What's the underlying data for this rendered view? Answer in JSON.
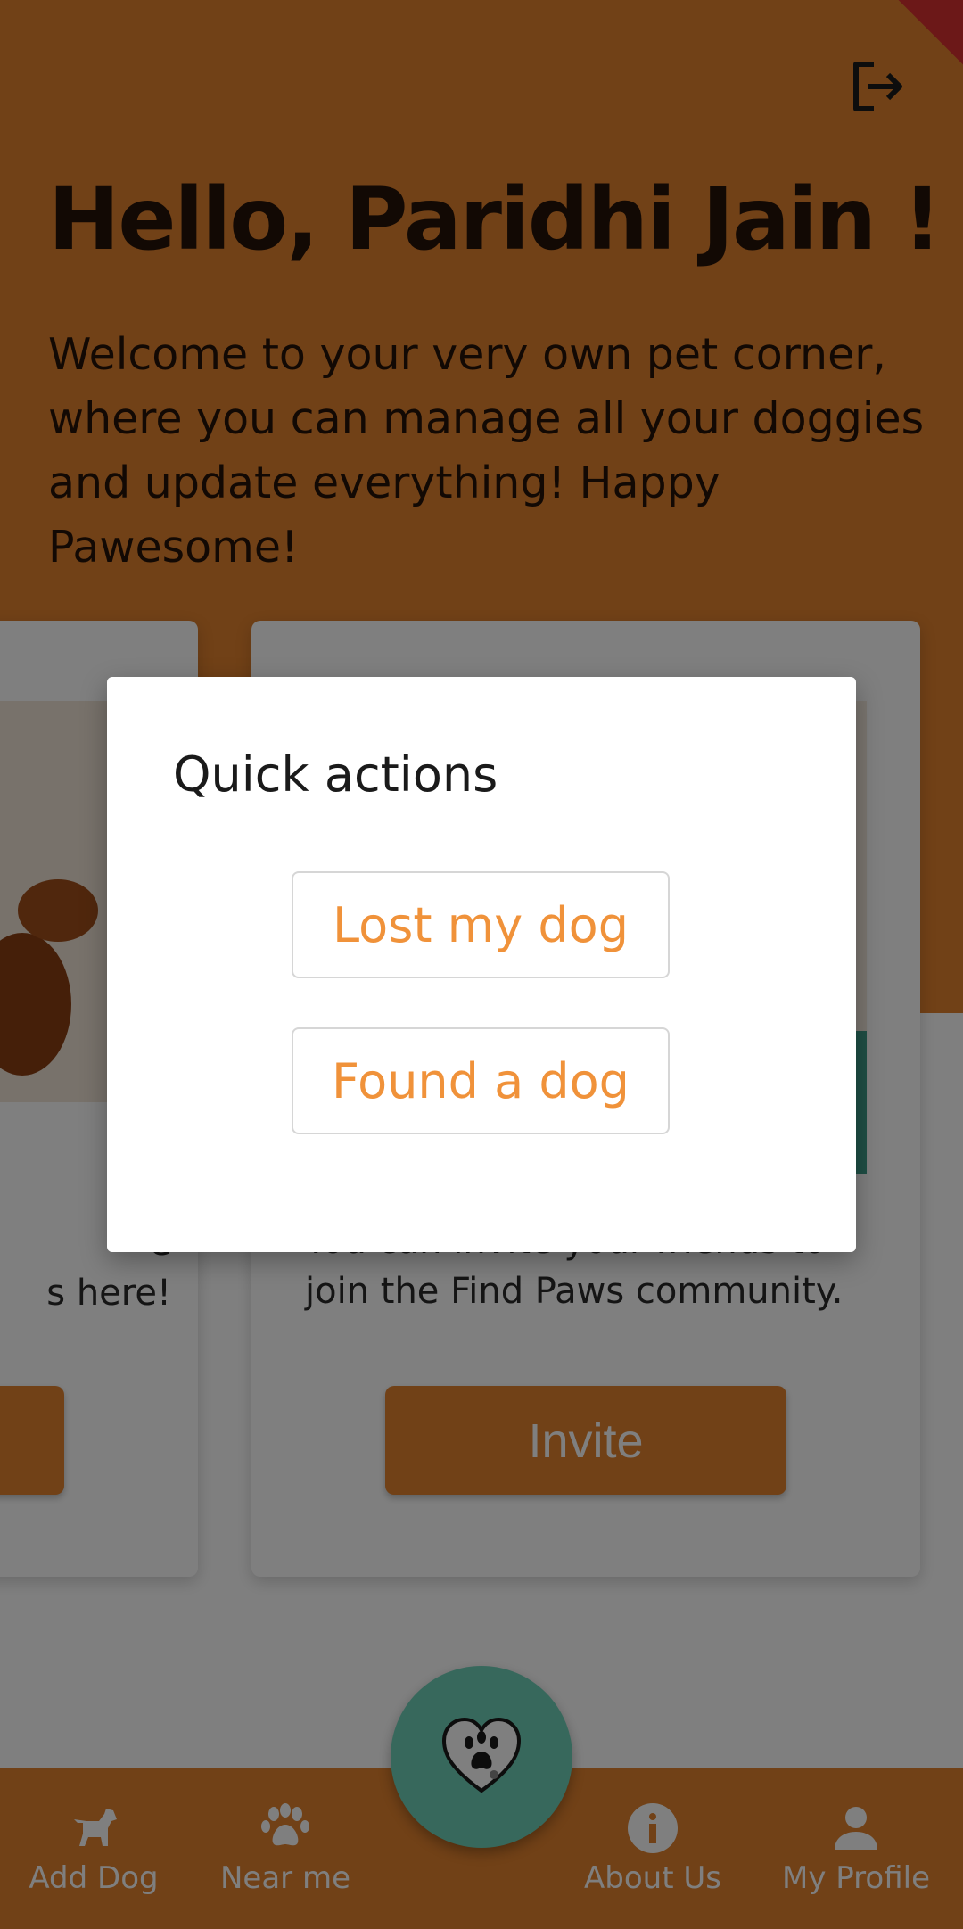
{
  "header": {
    "greeting": "Hello, Paridhi Jain !",
    "welcome": "Welcome to your very own pet corner, where you can manage all your doggies and update everything! Happy Pawesome!"
  },
  "cards": {
    "left": {
      "text_line1": "e",
      "text_line2": "s here!"
    },
    "right": {
      "text": "You can invite your friends to join the Find Paws community.",
      "button_label": "Invite"
    }
  },
  "dialog": {
    "title": "Quick actions",
    "actions": [
      {
        "label": "Lost my dog"
      },
      {
        "label": "Found a dog"
      }
    ]
  },
  "bottom_nav": {
    "items": [
      {
        "label": "Add Dog",
        "icon": "dog-icon"
      },
      {
        "label": "Near me",
        "icon": "paw-icon"
      },
      {
        "label": "About Us",
        "icon": "info-icon"
      },
      {
        "label": "My Profile",
        "icon": "person-icon"
      }
    ],
    "center_icon": "heart-paw-icon"
  },
  "colors": {
    "brand_orange": "#e2822e",
    "accent_teal": "#6fd1b9",
    "action_text": "#f0923a"
  }
}
